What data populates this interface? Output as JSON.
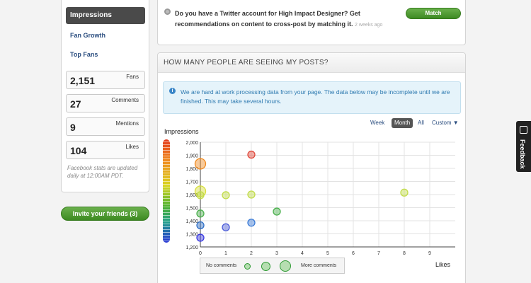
{
  "sidebar": {
    "nav_active": "Impressions",
    "nav_links": [
      "Fan Growth",
      "Top Fans"
    ],
    "stats": [
      {
        "value": "2,151",
        "label": "Fans"
      },
      {
        "value": "27",
        "label": "Comments"
      },
      {
        "value": "9",
        "label": "Mentions"
      },
      {
        "value": "104",
        "label": "Likes"
      }
    ],
    "note": "Facebook stats are updated daily at 12:00AM PDT."
  },
  "invite_button": "Invite your friends (3)",
  "recommendation": {
    "text": "Do you have a Twitter account for High Impact Designer? Get recommendations on content to cross-post by matching it.",
    "time": "2 weeks ago",
    "button": "Match"
  },
  "panel": {
    "title": "HOW MANY PEOPLE ARE SEEING MY POSTS?",
    "info_icon": "info-icon",
    "info_text": "We are hard at work processing data from your page. The data below may be incomplete until we are finished. This may take several hours.",
    "range_tabs": [
      "Week",
      "Month",
      "All",
      "Custom ▼"
    ],
    "active_range": "Month"
  },
  "legend": {
    "left": "No comments",
    "right": "More comments"
  },
  "feedback": {
    "label": "Feedback",
    "icon": "feedback-icon"
  },
  "colors": {
    "green_button": "#4a9a30",
    "active_nav": "#4a4a4a",
    "info_bg": "#e5f3fa",
    "link": "#2a4d7f"
  },
  "chart_data": {
    "type": "scatter",
    "title": "",
    "xlabel": "Likes",
    "ylabel": "Impressions",
    "xlim": [
      0,
      10
    ],
    "ylim": [
      1200,
      2000
    ],
    "x_ticks": [
      0,
      1,
      2,
      3,
      4,
      5,
      6,
      7,
      8,
      9
    ],
    "y_ticks": [
      "1,200",
      "1,300",
      "1,400",
      "1,500",
      "1,600",
      "1,700",
      "1,800",
      "1,900",
      "2,000"
    ],
    "grid": true,
    "points": [
      {
        "x": 2,
        "y": 1905,
        "comments": 1,
        "color": "#e04a3c"
      },
      {
        "x": 0,
        "y": 1835,
        "comments": 2,
        "color": "#f08a1f"
      },
      {
        "x": 0,
        "y": 1625,
        "comments": 2,
        "color": "#d6de3a"
      },
      {
        "x": 1,
        "y": 1595,
        "comments": 1,
        "color": "#c2dc4a"
      },
      {
        "x": 2,
        "y": 1600,
        "comments": 1,
        "color": "#c2dc4a"
      },
      {
        "x": 8,
        "y": 1615,
        "comments": 1,
        "color": "#c2dc4a"
      },
      {
        "x": 0,
        "y": 1595,
        "comments": 1,
        "color": "#c2dc4a"
      },
      {
        "x": 3,
        "y": 1470,
        "comments": 1,
        "color": "#4cb04e"
      },
      {
        "x": 0,
        "y": 1455,
        "comments": 1,
        "color": "#4cb04e"
      },
      {
        "x": 2,
        "y": 1385,
        "comments": 1,
        "color": "#3b7bd6"
      },
      {
        "x": 0,
        "y": 1365,
        "comments": 1,
        "color": "#2f6fc6"
      },
      {
        "x": 1,
        "y": 1350,
        "comments": 1,
        "color": "#4a5ad8"
      },
      {
        "x": 0,
        "y": 1270,
        "comments": 1,
        "color": "#3a3ae0"
      }
    ],
    "legend": [
      "No comments",
      "More comments"
    ]
  }
}
